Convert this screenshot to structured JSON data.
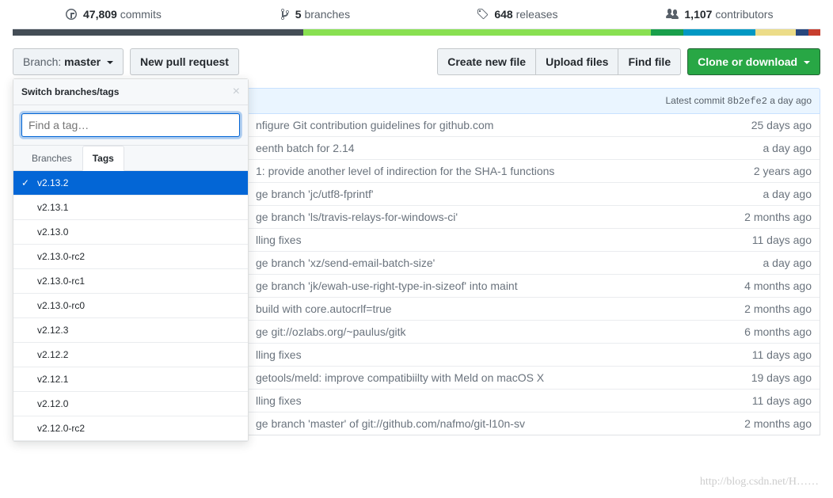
{
  "stats": {
    "commits": {
      "count": "47,809",
      "label": "commits"
    },
    "branches": {
      "count": "5",
      "label": "branches"
    },
    "releases": {
      "count": "648",
      "label": "releases"
    },
    "contributors": {
      "count": "1,107",
      "label": "contributors"
    }
  },
  "toolbar": {
    "branch_label": "Branch:",
    "branch_name": "master",
    "new_pr": "New pull request",
    "create_file": "Create new file",
    "upload_files": "Upload files",
    "find_file": "Find file",
    "clone": "Clone or download"
  },
  "selector": {
    "title": "Switch branches/tags",
    "placeholder": "Find a tag…",
    "tab_branches": "Branches",
    "tab_tags": "Tags",
    "tags": [
      "v2.13.2",
      "v2.13.1",
      "v2.13.0",
      "v2.13.0-rc2",
      "v2.13.0-rc1",
      "v2.13.0-rc0",
      "v2.12.3",
      "v2.12.2",
      "v2.12.1",
      "v2.12.0",
      "v2.12.0-rc2"
    ]
  },
  "commit_bar": {
    "prefix": "Latest commit",
    "sha": "8b2efe2",
    "time": "a day ago"
  },
  "files": [
    {
      "msg": "nfigure Git contribution guidelines for github.com",
      "time": "25 days ago"
    },
    {
      "msg": "eenth batch for 2.14",
      "time": "a day ago"
    },
    {
      "msg": "1: provide another level of indirection for the SHA-1 functions",
      "time": "2 years ago"
    },
    {
      "msg": "ge branch 'jc/utf8-fprintf'",
      "time": "a day ago"
    },
    {
      "msg": "ge branch 'ls/travis-relays-for-windows-ci'",
      "time": "2 months ago"
    },
    {
      "msg": "lling fixes",
      "time": "11 days ago"
    },
    {
      "msg": "ge branch 'xz/send-email-batch-size'",
      "time": "a day ago"
    },
    {
      "msg": "ge branch 'jk/ewah-use-right-type-in-sizeof' into maint",
      "time": "4 months ago"
    },
    {
      "msg": "build with core.autocrlf=true",
      "time": "2 months ago"
    },
    {
      "msg": "ge git://ozlabs.org/~paulus/gitk",
      "time": "6 months ago"
    },
    {
      "msg": "lling fixes",
      "time": "11 days ago"
    },
    {
      "msg": "getools/meld: improve compatibiilty with Meld on macOS X",
      "time": "19 days ago"
    },
    {
      "msg": "lling fixes",
      "time": "11 days ago"
    },
    {
      "msg": "ge branch 'master' of git://github.com/nafmo/git-l10n-sv",
      "time": "2 months ago"
    }
  ],
  "watermark": "http://blog.csdn.net/H……"
}
